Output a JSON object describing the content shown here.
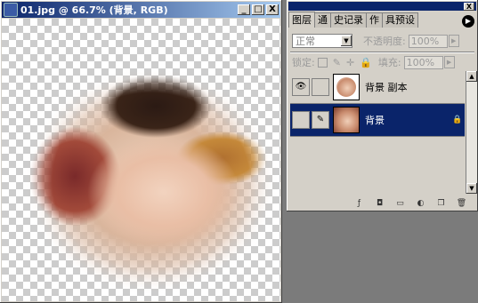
{
  "document": {
    "title": "01.jpg @ 66.7% (背景, RGB)",
    "buttons": {
      "minimize": "_",
      "maximize": "□",
      "close": "X"
    }
  },
  "panel": {
    "tabs": [
      "图层",
      "通道",
      "历史记录",
      "动作",
      "工具预设"
    ],
    "tab_display": [
      "图层",
      "通",
      "史记录",
      "作",
      "具预设"
    ],
    "close": "X",
    "blend_mode": "正常",
    "opacity_label": "不透明度:",
    "opacity_value": "100%",
    "lock_label": "锁定:",
    "fill_label": "填充:",
    "fill_value": "100%",
    "layers": [
      {
        "name": "背景 副本",
        "visible": true,
        "selected": false
      },
      {
        "name": "背景",
        "visible": false,
        "selected": true,
        "locked": true
      }
    ],
    "bottom_icons": [
      "layer-style-icon",
      "mask-icon",
      "folder-icon",
      "adjustment-icon",
      "new-layer-icon",
      "trash-icon"
    ]
  }
}
